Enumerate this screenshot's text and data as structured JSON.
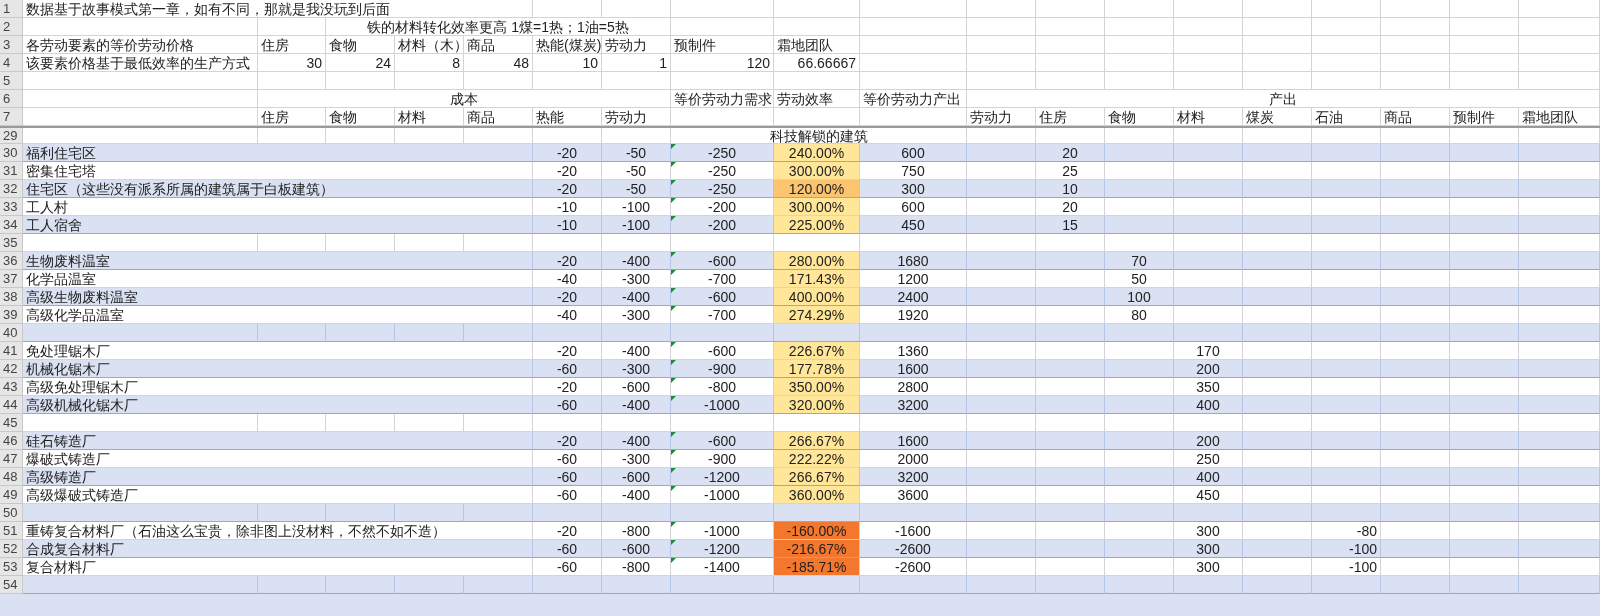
{
  "rows": [
    {
      "number": "1",
      "kind": "label",
      "shaded": false,
      "cells": [
        "数据基于故事模式第一章，如有不同，那就是我没玩到后面"
      ]
    },
    {
      "number": "2",
      "kind": "label",
      "shaded": false,
      "cells": [
        null,
        null,
        "铁的材料转化效率更高  1煤=1热；1油=5热"
      ]
    },
    {
      "number": "3",
      "kind": "label",
      "shaded": false,
      "cells": [
        "各劳动要素的等价劳动价格",
        "住房",
        "食物",
        "材料（木）",
        "商品",
        "热能(煤炭)",
        "劳动力",
        "预制件",
        "霜地团队"
      ]
    },
    {
      "number": "4",
      "kind": "number",
      "shaded": false,
      "cells": [
        "该要素价格基于最低效率的生产方式",
        "30",
        "24",
        "8",
        "48",
        "10",
        "1",
        "120",
        "66.66667"
      ]
    },
    {
      "number": "5",
      "kind": "label",
      "shaded": false,
      "cells": []
    },
    {
      "number": "6",
      "kind": "label",
      "shaded": false,
      "cells": [
        null,
        "成本",
        null,
        null,
        null,
        null,
        null,
        "等价劳动力需求",
        "劳动效率",
        "等价劳动力产出",
        "产出"
      ]
    },
    {
      "number": "7",
      "kind": "label",
      "shaded": false,
      "cells": [
        null,
        "住房",
        "食物",
        "材料",
        "商品",
        "热能",
        "劳动力",
        null,
        null,
        null,
        "劳动力",
        "住房",
        "食物",
        "材料",
        "煤炭",
        "石油",
        "商品",
        "预制件",
        "霜地团队"
      ]
    },
    {
      "number": "29",
      "kind": "section",
      "shaded": false,
      "cells": [
        null,
        null,
        null,
        null,
        null,
        null,
        null,
        "科技解锁的建筑"
      ]
    },
    {
      "number": "30",
      "kind": "data",
      "shaded": true,
      "cells": [
        "福利住宅区",
        null,
        null,
        null,
        null,
        "-20",
        "-50",
        {
          "text": "-250",
          "error_mark": true
        },
        {
          "text": "240.00%",
          "color": "#ffe699"
        },
        "600",
        null,
        "20"
      ]
    },
    {
      "number": "31",
      "kind": "data",
      "shaded": false,
      "cells": [
        "密集住宅塔",
        null,
        null,
        null,
        null,
        "-20",
        "-50",
        {
          "text": "-250",
          "error_mark": true
        },
        {
          "text": "300.00%",
          "color": "#ffe699"
        },
        "750",
        null,
        "25"
      ]
    },
    {
      "number": "32",
      "kind": "data",
      "shaded": true,
      "cells": [
        "住宅区（这些没有派系所属的建筑属于白板建筑）",
        null,
        null,
        null,
        null,
        "-20",
        "-50",
        {
          "text": "-250",
          "error_mark": true
        },
        {
          "text": "120.00%",
          "color": "#fbc46e"
        },
        "300",
        null,
        "10"
      ]
    },
    {
      "number": "33",
      "kind": "data",
      "shaded": false,
      "cells": [
        "工人村",
        null,
        null,
        null,
        null,
        "-10",
        "-100",
        {
          "text": "-200",
          "error_mark": true
        },
        {
          "text": "300.00%",
          "color": "#ffe699"
        },
        "600",
        null,
        "20"
      ]
    },
    {
      "number": "34",
      "kind": "data",
      "shaded": true,
      "cells": [
        "工人宿舍",
        null,
        null,
        null,
        null,
        "-10",
        "-100",
        {
          "text": "-200",
          "error_mark": true
        },
        {
          "text": "225.00%",
          "color": "#ffe699"
        },
        "450",
        null,
        "15"
      ]
    },
    {
      "number": "35",
      "kind": "data",
      "shaded": false,
      "cells": []
    },
    {
      "number": "36",
      "kind": "data",
      "shaded": true,
      "cells": [
        "生物废料温室",
        null,
        null,
        null,
        null,
        "-20",
        "-400",
        {
          "text": "-600",
          "error_mark": true
        },
        {
          "text": "280.00%",
          "color": "#ffe699"
        },
        "1680",
        null,
        null,
        "70"
      ]
    },
    {
      "number": "37",
      "kind": "data",
      "shaded": false,
      "cells": [
        "化学品温室",
        null,
        null,
        null,
        null,
        "-40",
        "-300",
        {
          "text": "-700",
          "error_mark": true
        },
        {
          "text": "171.43%",
          "color": "#ffe699"
        },
        "1200",
        null,
        null,
        "50"
      ]
    },
    {
      "number": "38",
      "kind": "data",
      "shaded": true,
      "cells": [
        "高级生物废料温室",
        null,
        null,
        null,
        null,
        "-20",
        "-400",
        {
          "text": "-600",
          "error_mark": true
        },
        {
          "text": "400.00%",
          "color": "#ffe699"
        },
        "2400",
        null,
        null,
        "100"
      ]
    },
    {
      "number": "39",
      "kind": "data",
      "shaded": false,
      "cells": [
        "高级化学品温室",
        null,
        null,
        null,
        null,
        "-40",
        "-300",
        {
          "text": "-700",
          "error_mark": true
        },
        {
          "text": "274.29%",
          "color": "#ffe699"
        },
        "1920",
        null,
        null,
        "80"
      ]
    },
    {
      "number": "40",
      "kind": "data",
      "shaded": true,
      "cells": []
    },
    {
      "number": "41",
      "kind": "data",
      "shaded": false,
      "cells": [
        "免处理锯木厂",
        null,
        null,
        null,
        null,
        "-20",
        "-400",
        {
          "text": "-600",
          "error_mark": true
        },
        {
          "text": "226.67%",
          "color": "#ffe699"
        },
        "1360",
        null,
        null,
        null,
        "170"
      ]
    },
    {
      "number": "42",
      "kind": "data",
      "shaded": true,
      "cells": [
        "机械化锯木厂",
        null,
        null,
        null,
        null,
        "-60",
        "-300",
        {
          "text": "-900",
          "error_mark": true
        },
        {
          "text": "177.78%",
          "color": "#ffe699"
        },
        "1600",
        null,
        null,
        null,
        "200"
      ]
    },
    {
      "number": "43",
      "kind": "data",
      "shaded": false,
      "cells": [
        "高级免处理锯木厂",
        null,
        null,
        null,
        null,
        "-20",
        "-600",
        {
          "text": "-800",
          "error_mark": true
        },
        {
          "text": "350.00%",
          "color": "#ffe699"
        },
        "2800",
        null,
        null,
        null,
        "350"
      ]
    },
    {
      "number": "44",
      "kind": "data",
      "shaded": true,
      "cells": [
        "高级机械化锯木厂",
        null,
        null,
        null,
        null,
        "-60",
        "-400",
        {
          "text": "-1000",
          "error_mark": true
        },
        {
          "text": "320.00%",
          "color": "#ffe699"
        },
        "3200",
        null,
        null,
        null,
        "400"
      ]
    },
    {
      "number": "45",
      "kind": "data",
      "shaded": false,
      "cells": []
    },
    {
      "number": "46",
      "kind": "data",
      "shaded": true,
      "cells": [
        "硅石铸造厂",
        null,
        null,
        null,
        null,
        "-20",
        "-400",
        {
          "text": "-600",
          "error_mark": true
        },
        {
          "text": "266.67%",
          "color": "#ffe699"
        },
        "1600",
        null,
        null,
        null,
        "200"
      ]
    },
    {
      "number": "47",
      "kind": "data",
      "shaded": false,
      "cells": [
        "爆破式铸造厂",
        null,
        null,
        null,
        null,
        "-60",
        "-300",
        {
          "text": "-900",
          "error_mark": true
        },
        {
          "text": "222.22%",
          "color": "#ffe699"
        },
        "2000",
        null,
        null,
        null,
        "250"
      ]
    },
    {
      "number": "48",
      "kind": "data",
      "shaded": true,
      "cells": [
        "高级铸造厂",
        null,
        null,
        null,
        null,
        "-60",
        "-600",
        {
          "text": "-1200",
          "error_mark": true
        },
        {
          "text": "266.67%",
          "color": "#ffe699"
        },
        "3200",
        null,
        null,
        null,
        "400"
      ]
    },
    {
      "number": "49",
      "kind": "data",
      "shaded": false,
      "cells": [
        "高级爆破式铸造厂",
        null,
        null,
        null,
        null,
        "-60",
        "-400",
        {
          "text": "-1000",
          "error_mark": true
        },
        {
          "text": "360.00%",
          "color": "#ffe699"
        },
        "3600",
        null,
        null,
        null,
        "450"
      ]
    },
    {
      "number": "50",
      "kind": "data",
      "shaded": true,
      "cells": []
    },
    {
      "number": "51",
      "kind": "data",
      "shaded": false,
      "cells": [
        "重铸复合材料厂（石油这么宝贵，除非图上没材料，不然不如不造）",
        null,
        null,
        null,
        null,
        "-20",
        "-800",
        {
          "text": "-1000",
          "error_mark": true
        },
        {
          "text": "-160.00%",
          "color": "#f4772e"
        },
        "-1600",
        null,
        null,
        null,
        "300",
        null,
        "-80"
      ]
    },
    {
      "number": "52",
      "kind": "data",
      "shaded": true,
      "cells": [
        "合成复合材料厂",
        null,
        null,
        null,
        null,
        "-60",
        "-600",
        {
          "text": "-1200",
          "error_mark": true
        },
        {
          "text": "-216.67%",
          "color": "#f4772e"
        },
        "-2600",
        null,
        null,
        null,
        "300",
        null,
        "-100"
      ]
    },
    {
      "number": "53",
      "kind": "data",
      "shaded": false,
      "cells": [
        "复合材料厂",
        null,
        null,
        null,
        null,
        "-60",
        "-800",
        {
          "text": "-1400",
          "error_mark": true
        },
        {
          "text": "-185.71%",
          "color": "#f4772e"
        },
        "-2600",
        null,
        null,
        null,
        "300",
        null,
        "-100"
      ]
    },
    {
      "number": "54",
      "kind": "data",
      "shaded": true,
      "cells": []
    }
  ]
}
